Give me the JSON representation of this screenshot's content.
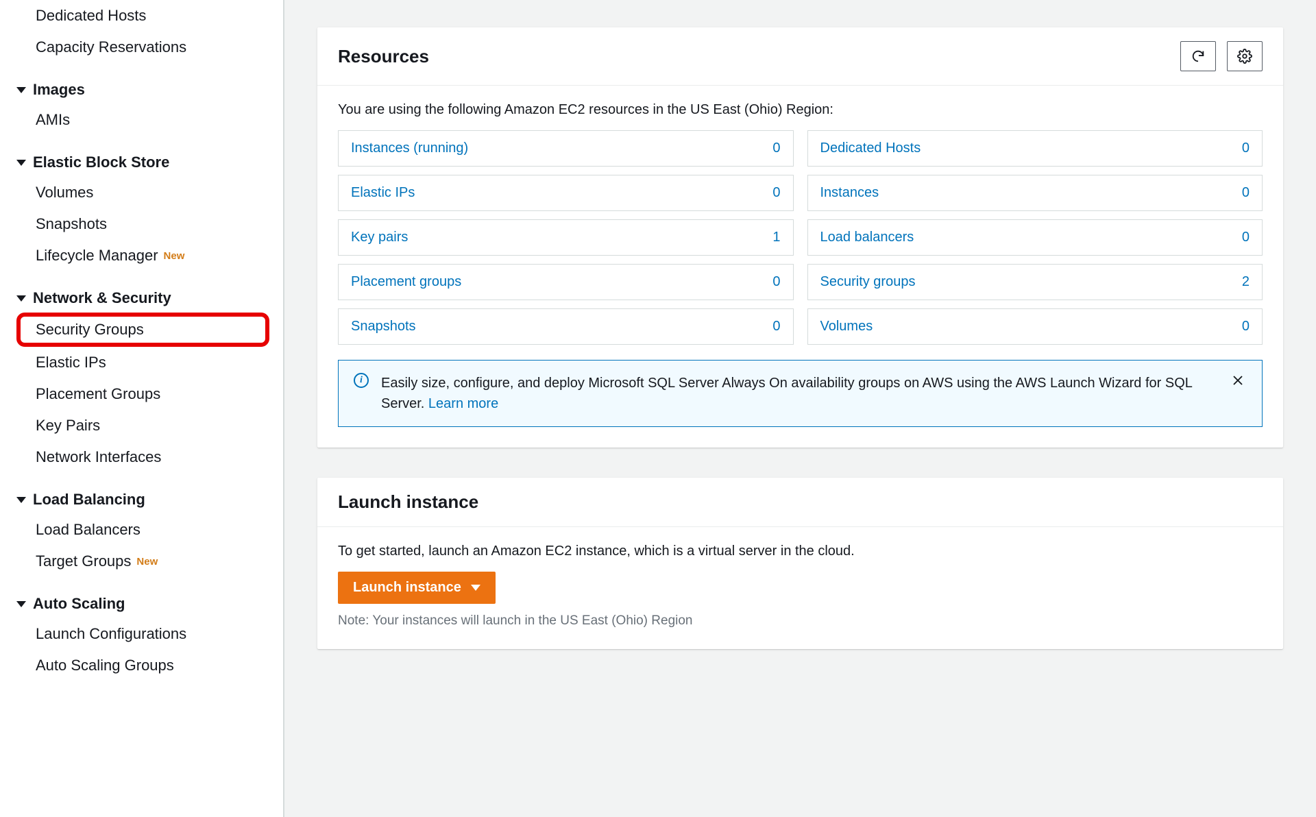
{
  "sidebar": {
    "top_items": [
      "Dedicated Hosts",
      "Capacity Reservations"
    ],
    "sections": [
      {
        "title": "Images",
        "items": [
          {
            "label": "AMIs"
          }
        ]
      },
      {
        "title": "Elastic Block Store",
        "items": [
          {
            "label": "Volumes"
          },
          {
            "label": "Snapshots"
          },
          {
            "label": "Lifecycle Manager",
            "badge": "New"
          }
        ]
      },
      {
        "title": "Network & Security",
        "items": [
          {
            "label": "Security Groups",
            "highlighted": true
          },
          {
            "label": "Elastic IPs"
          },
          {
            "label": "Placement Groups"
          },
          {
            "label": "Key Pairs"
          },
          {
            "label": "Network Interfaces"
          }
        ]
      },
      {
        "title": "Load Balancing",
        "items": [
          {
            "label": "Load Balancers"
          },
          {
            "label": "Target Groups",
            "badge": "New"
          }
        ]
      },
      {
        "title": "Auto Scaling",
        "items": [
          {
            "label": "Launch Configurations"
          },
          {
            "label": "Auto Scaling Groups"
          }
        ]
      }
    ]
  },
  "resources": {
    "title": "Resources",
    "intro": "You are using the following Amazon EC2 resources in the US East (Ohio) Region:",
    "tiles": [
      {
        "label": "Instances (running)",
        "count": 0
      },
      {
        "label": "Dedicated Hosts",
        "count": 0
      },
      {
        "label": "Elastic IPs",
        "count": 0
      },
      {
        "label": "Instances",
        "count": 0
      },
      {
        "label": "Key pairs",
        "count": 1
      },
      {
        "label": "Load balancers",
        "count": 0
      },
      {
        "label": "Placement groups",
        "count": 0
      },
      {
        "label": "Security groups",
        "count": 2
      },
      {
        "label": "Snapshots",
        "count": 0
      },
      {
        "label": "Volumes",
        "count": 0
      }
    ],
    "info": {
      "text": "Easily size, configure, and deploy Microsoft SQL Server Always On availability groups on AWS using the AWS Launch Wizard for SQL Server. ",
      "link": "Learn more"
    }
  },
  "launch": {
    "title": "Launch instance",
    "text": "To get started, launch an Amazon EC2 instance, which is a virtual server in the cloud.",
    "button": "Launch instance",
    "note": "Note: Your instances will launch in the US East (Ohio) Region"
  }
}
